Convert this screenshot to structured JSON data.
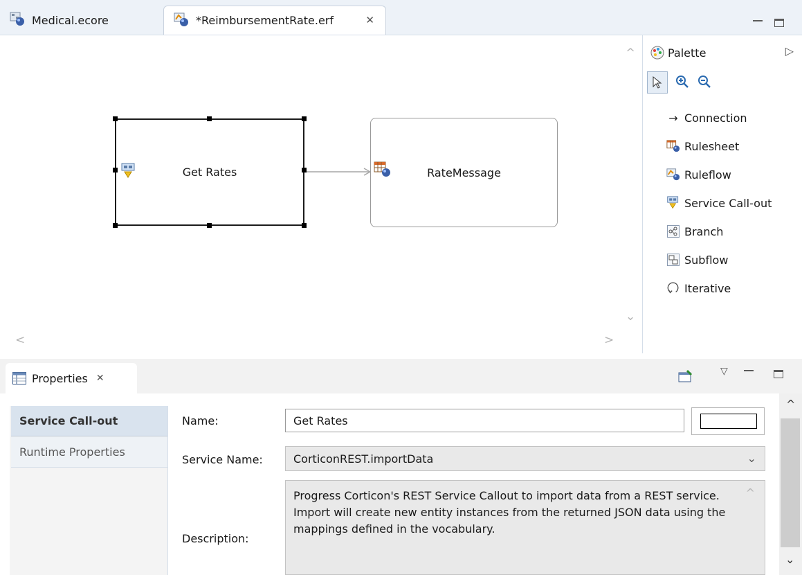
{
  "editor": {
    "tabs": [
      {
        "label": "Medical.ecore",
        "icon": "ecore-model-icon",
        "active": false
      },
      {
        "label": "*ReimbursementRate.erf",
        "icon": "ruleflow-icon",
        "active": true
      }
    ],
    "tab_close_glyph": "✕"
  },
  "canvas": {
    "nodes": [
      {
        "label": "Get Rates",
        "type": "Service Call-out",
        "selected": true
      },
      {
        "label": "RateMessage",
        "type": "Rulesheet",
        "selected": false
      }
    ]
  },
  "palette": {
    "title": "Palette",
    "items": [
      {
        "label": "Connection",
        "icon": "arrow-icon"
      },
      {
        "label": "Rulesheet",
        "icon": "rulesheet-icon"
      },
      {
        "label": "Ruleflow",
        "icon": "ruleflow-icon"
      },
      {
        "label": "Service Call-out",
        "icon": "service-callout-icon"
      },
      {
        "label": "Branch",
        "icon": "branch-icon"
      },
      {
        "label": "Subflow",
        "icon": "subflow-icon"
      },
      {
        "label": "Iterative",
        "icon": "iterative-icon"
      }
    ]
  },
  "properties": {
    "tab_label": "Properties",
    "side_tabs": [
      "Service Call-out",
      "Runtime Properties"
    ],
    "name_label": "Name:",
    "name_value": "Get Rates",
    "service_label": "Service Name:",
    "service_value": "CorticonREST.importData",
    "description_label": "Description:",
    "description_value": "Progress Corticon's REST Service Callout to import data from a REST service. Import will create new entity instances from the returned JSON data using the mappings defined in the vocabulary."
  },
  "colors": {
    "tab_strip": "#edf2f8",
    "selected_side_tab": "#d9e3ee",
    "readonly_field": "#e9e9e9"
  }
}
